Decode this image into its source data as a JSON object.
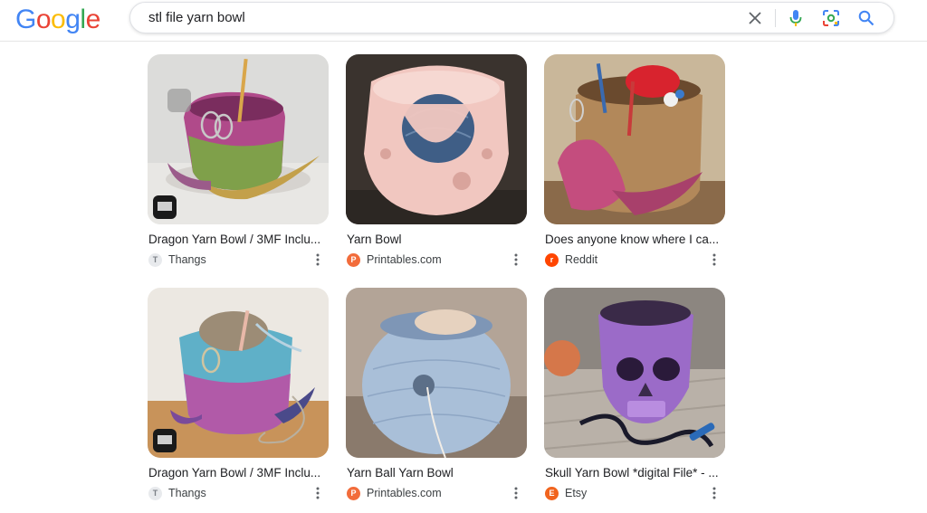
{
  "logo": {
    "text": "Google",
    "letters": [
      "G",
      "o",
      "o",
      "g",
      "l",
      "e"
    ],
    "colors": [
      "#4285F4",
      "#EA4335",
      "#FBBC05",
      "#4285F4",
      "#34A853",
      "#EA4335"
    ]
  },
  "search": {
    "query": "stl file yarn bowl"
  },
  "results": [
    {
      "title": "Dragon Yarn Bowl / 3MF Inclu...",
      "source": "Thangs",
      "favicon": "thangs-icon",
      "fav_color": "#9aa0a6"
    },
    {
      "title": "Yarn Bowl",
      "source": "Printables.com",
      "favicon": "printables-icon",
      "fav_color": "#f26c3b"
    },
    {
      "title": "Does anyone know where I ca...",
      "source": "Reddit",
      "favicon": "reddit-icon",
      "fav_color": "#ff4500"
    },
    {
      "title": "Dragon Yarn Bowl / 3MF Inclu...",
      "source": "Thangs",
      "favicon": "thangs-icon",
      "fav_color": "#9aa0a6"
    },
    {
      "title": "Yarn Ball Yarn Bowl",
      "source": "Printables.com",
      "favicon": "printables-icon",
      "fav_color": "#f26c3b"
    },
    {
      "title": "Skull Yarn Bowl *digital File* - ...",
      "source": "Etsy",
      "favicon": "etsy-icon",
      "fav_color": "#f1641e"
    }
  ]
}
